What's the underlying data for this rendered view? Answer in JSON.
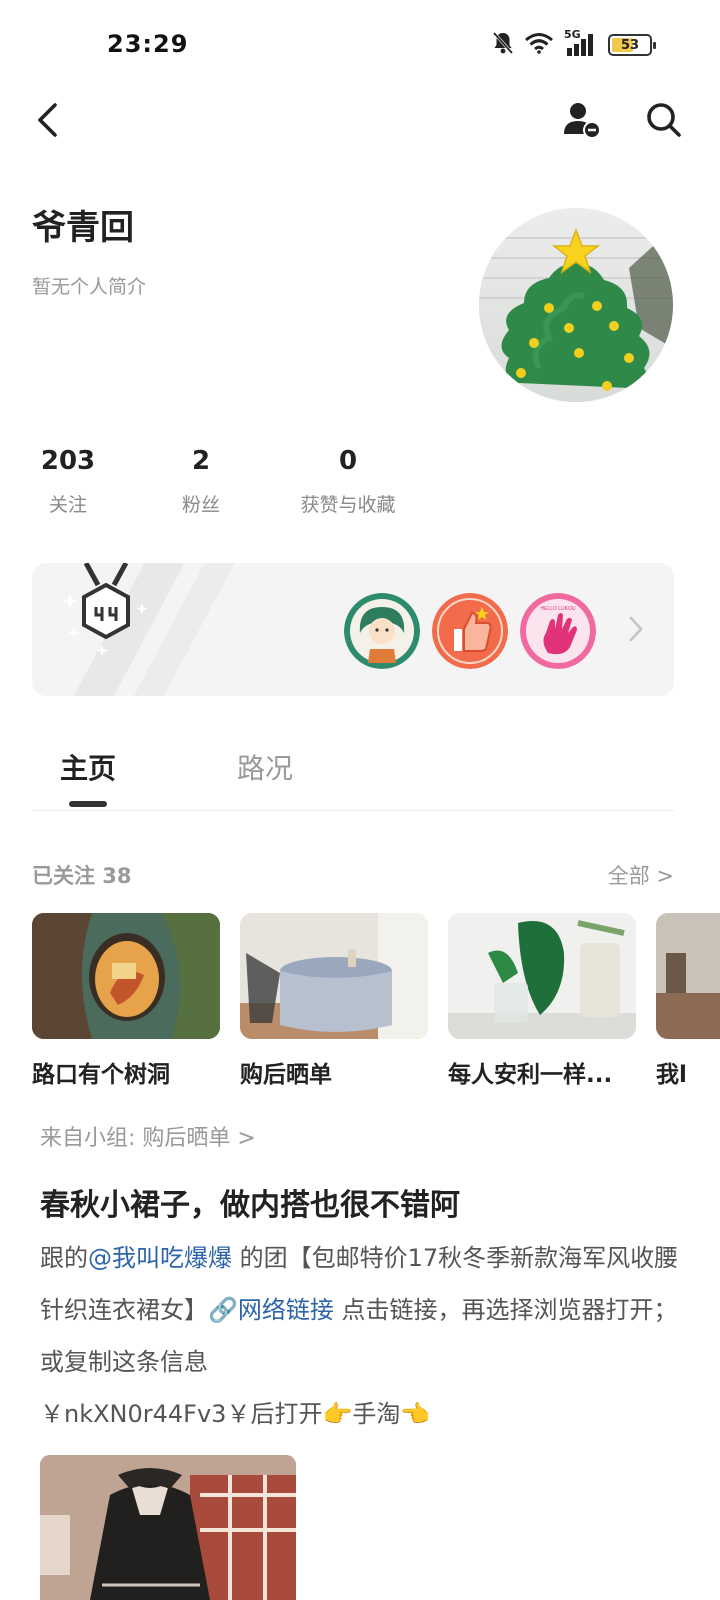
{
  "status_bar": {
    "time": "23:29",
    "network": "5G",
    "battery": "53",
    "battery_level": 0.53
  },
  "nav": {
    "back_icon": "chevron-left-icon",
    "actions": [
      "user-manage-icon",
      "search-icon"
    ]
  },
  "profile": {
    "name": "爷青回",
    "bio": "暂无个人简介"
  },
  "stats": [
    {
      "value": "203",
      "label": "关注"
    },
    {
      "value": "2",
      "label": "粉丝"
    },
    {
      "value": "0",
      "label": "获赞与收藏"
    }
  ],
  "badges": {
    "medal_icon": "medal-icon",
    "items": [
      "girl-avatar-badge",
      "thumbs-up-badge",
      "hello-hand-badge"
    ],
    "colors": {
      "green": "#2e8b6d",
      "orange": "#f26b4a",
      "pink": "#f06aa0"
    }
  },
  "tabs": [
    {
      "label": "主页",
      "active": true
    },
    {
      "label": "路况",
      "active": false
    }
  ],
  "followed": {
    "title": "已关注 38",
    "all_label": "全部 >",
    "groups": [
      {
        "name": "路口有个树洞"
      },
      {
        "name": "购后晒单"
      },
      {
        "name": "每人安利一样..."
      },
      {
        "name": "我l"
      }
    ]
  },
  "post": {
    "from": "来自小组: 购后晒单 >",
    "title": "春秋小裙子，做内搭也很不错阿",
    "body_prefix": "跟的",
    "mention": "@我叫吃爆爆",
    "body_mid": " 的团【包邮特价17秋冬季新款海军风收腰针织连衣裙女】",
    "link_text": "🔗网络链接",
    "body_suffix": " 点击链接，再选择浏览器打开；或复制这条信息",
    "code_line": "￥nkXN0r44Fv3￥后打开👉手淘👈"
  },
  "colors": {
    "link": "#2e64a9",
    "muted": "#999999",
    "text": "#222222",
    "card_bg": "#f4f4f5"
  }
}
